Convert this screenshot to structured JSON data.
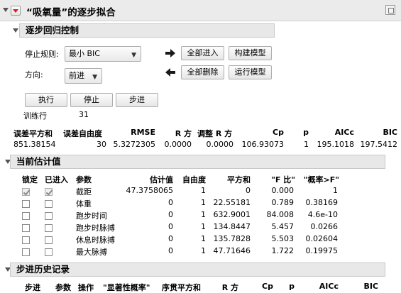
{
  "title": "“吸氧量”的逐步拟合",
  "control": {
    "header": "逐步回归控制",
    "stop_rule_label": "停止规则:",
    "stop_rule_value": "最小 BIC",
    "direction_label": "方向:",
    "direction_value": "前进",
    "enter_all": "全部进入",
    "build_model": "构建模型",
    "remove_all": "全部删除",
    "run_model": "运行模型",
    "go": "执行",
    "stop": "停止",
    "step": "步进",
    "rows_label": "训练行",
    "rows_value": "31"
  },
  "summary": {
    "headers": [
      "误差平方和",
      "误差自由度",
      "RMSE",
      "R 方",
      "调整 R 方",
      "Cp",
      "p",
      "AICc",
      "BIC"
    ],
    "values": [
      "851.38154",
      "30",
      "5.3272305",
      "0.0000",
      "0.0000",
      "106.93073",
      "1",
      "195.1018",
      "197.5412"
    ]
  },
  "estimates": {
    "header": "当前估计值",
    "columns": [
      "锁定",
      "已进入",
      "参数",
      "估计值",
      "自由度",
      "平方和",
      "\"F 比\"",
      "\"概率>F\""
    ],
    "rows": [
      {
        "lock": true,
        "entered": true,
        "param": "截距",
        "estimate": "47.3758065",
        "df": "1",
        "ss": "0",
        "f": "0.000",
        "p": "1"
      },
      {
        "lock": false,
        "entered": false,
        "param": "体重",
        "estimate": "0",
        "df": "1",
        "ss": "22.55181",
        "f": "0.789",
        "p": "0.38169"
      },
      {
        "lock": false,
        "entered": false,
        "param": "跑步时间",
        "estimate": "0",
        "df": "1",
        "ss": "632.9001",
        "f": "84.008",
        "p": "4.6e-10"
      },
      {
        "lock": false,
        "entered": false,
        "param": "跑步时脉搏",
        "estimate": "0",
        "df": "1",
        "ss": "134.8447",
        "f": "5.457",
        "p": "0.0266"
      },
      {
        "lock": false,
        "entered": false,
        "param": "休息时脉搏",
        "estimate": "0",
        "df": "1",
        "ss": "135.7828",
        "f": "5.503",
        "p": "0.02604"
      },
      {
        "lock": false,
        "entered": false,
        "param": "最大脉搏",
        "estimate": "0",
        "df": "1",
        "ss": "47.71646",
        "f": "1.722",
        "p": "0.19975"
      }
    ]
  },
  "history": {
    "header": "步进历史记录",
    "columns": [
      "步进",
      "参数",
      "操作",
      "\"显著性概率\"",
      "序贯平方和",
      "R 方",
      "Cp",
      "p",
      "AICc",
      "BIC"
    ]
  },
  "colors": {
    "accent_red": "#d81e1e",
    "header_bg": "#e8e8e8"
  }
}
